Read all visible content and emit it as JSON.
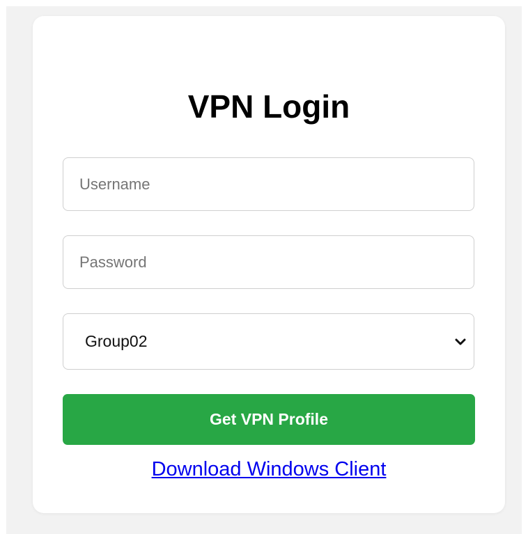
{
  "page": {
    "title": "VPN Login"
  },
  "form": {
    "username": {
      "value": "",
      "placeholder": "Username"
    },
    "password": {
      "value": "",
      "placeholder": "Password"
    },
    "group": {
      "selected": "Group02"
    },
    "submit_label": "Get VPN Profile",
    "download_link_label": "Download Windows Client"
  },
  "colors": {
    "button_bg": "#28a745",
    "link": "#0000ee",
    "page_bg": "#f2f2f2"
  },
  "icons": {
    "group_select": "chevron-down-icon"
  }
}
